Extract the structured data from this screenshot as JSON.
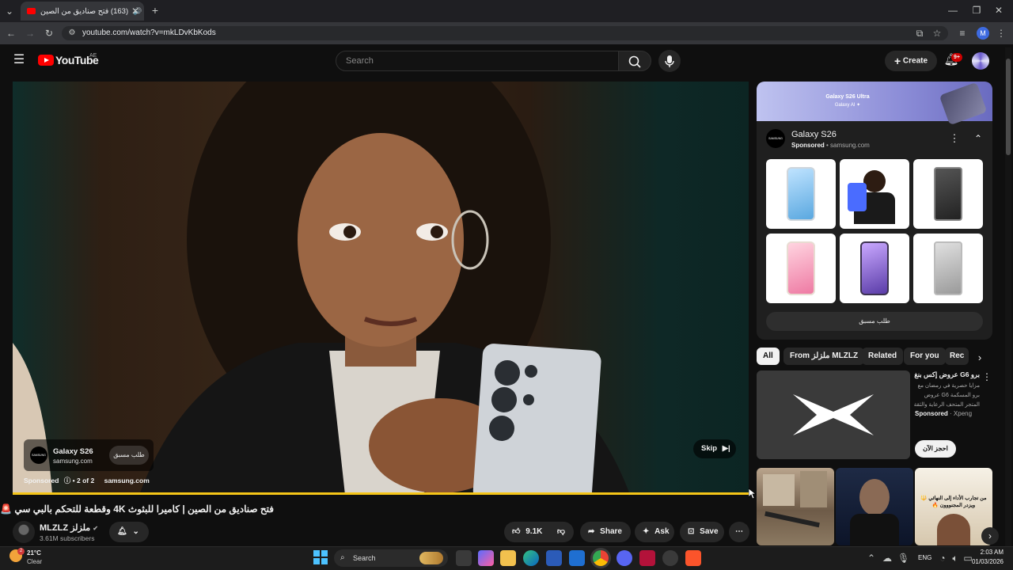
{
  "browser": {
    "tab_title": "(163) فتح صناديق من الصين",
    "url": "youtube.com/watch?v=mkLDvKbKods",
    "profile_letter": "M"
  },
  "youtube": {
    "logo": "YouTube",
    "region": "AE",
    "search_placeholder": "Search",
    "create_label": "Create",
    "notifications_badge": "9+"
  },
  "ad": {
    "advertiser": "Galaxy S26",
    "domain": "samsung.com",
    "cta": "طلب مسبق",
    "sponsored": "Sponsored",
    "counter": "• 2 of 2",
    "domain_bottom": "samsung.com",
    "skip": "Skip",
    "brand_mark": "SAMSUNG"
  },
  "video": {
    "title": "فتح صناديق من الصين | كاميرا للبثوث 4K وقطعة للتحكم بالبي سي 🚨 🚨",
    "channel": "MLZLZ ملزلز",
    "subscribers": "3.61M subscribers",
    "likes": "9.1K",
    "share_label": "Share",
    "ask_label": "Ask",
    "save_label": "Save"
  },
  "companion": {
    "banner_title": "Galaxy S26 Ultra",
    "banner_sub": "Galaxy AI ✦",
    "title": "Galaxy S26",
    "sponsored": "Sponsored",
    "domain": "• samsung.com",
    "cta": "طلب مسبق",
    "brand_mark": "SAMSUNG"
  },
  "chips": [
    "All",
    "From ملزلز MLZLZ",
    "Related",
    "For you",
    "Rec"
  ],
  "promo": {
    "title": "برو G6 عروض إكس بنغ",
    "description": "مزايا حصرية في رمضان مع برو المسكمة G6 عروض المتجر المتحف الرعاية والثقة",
    "sponsored": "Sponsored",
    "brand": "· Xpeng",
    "cta": "احجز الآن"
  },
  "shorts": [
    {
      "caption": ""
    },
    {
      "caption": ""
    },
    {
      "caption": "من تجارب الأداء إلى النهائي 🔱 ويزدر المجنووون 🔥"
    }
  ],
  "taskbar": {
    "temperature": "21°C",
    "weather": "Clear",
    "weather_badge": "2",
    "search_label": "Search",
    "language": "ENG",
    "time": "2:03 AM",
    "date": "01/03/2026"
  },
  "colors": {
    "youtube_red": "#ff0000",
    "progress_yellow": "#f5c518",
    "chrome_dark": "#35363a"
  }
}
